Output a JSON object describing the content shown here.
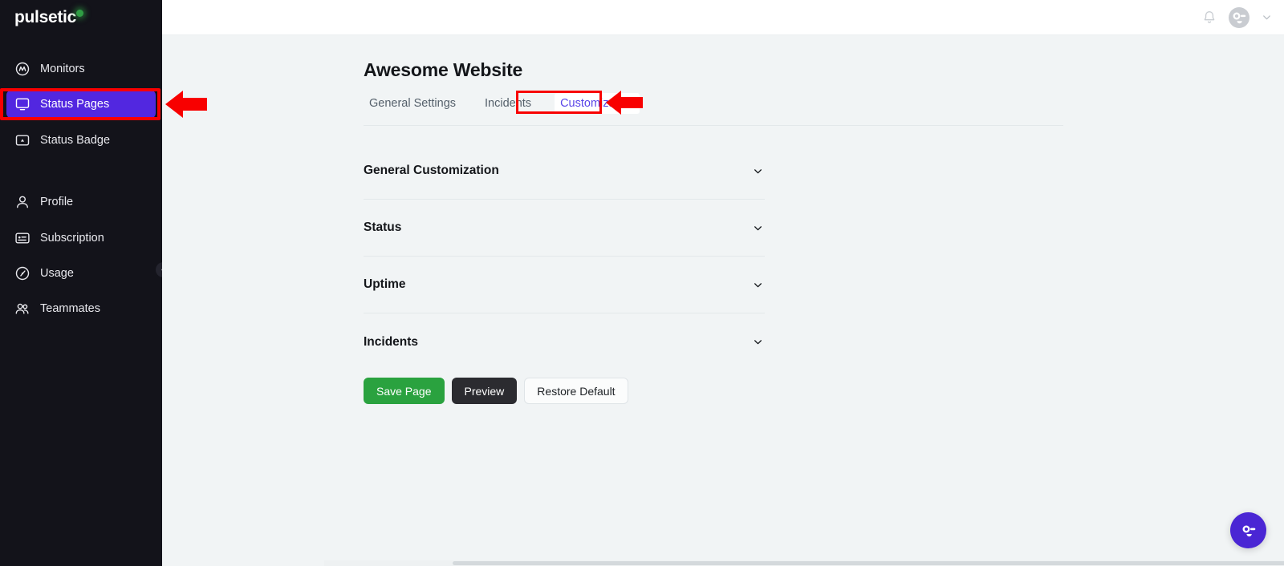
{
  "brand": {
    "name": "pulsetic",
    "dot_color": "#2f9e44",
    "accent": "#5227e0"
  },
  "sidebar": {
    "items": [
      {
        "label": "Monitors",
        "icon": "monitors-icon",
        "active": false
      },
      {
        "label": "Status Pages",
        "icon": "status-pages-icon",
        "active": true
      },
      {
        "label": "Status Badge",
        "icon": "status-badge-icon",
        "active": false
      },
      {
        "label": "Profile",
        "icon": "profile-icon",
        "active": false
      },
      {
        "label": "Subscription",
        "icon": "subscription-icon",
        "active": false
      },
      {
        "label": "Usage",
        "icon": "usage-icon",
        "active": false
      },
      {
        "label": "Teammates",
        "icon": "teammates-icon",
        "active": false
      }
    ],
    "collapse_icon": "chevron-left-icon"
  },
  "header": {
    "notifications_icon": "bell-icon",
    "avatar_icon": "avatar-face-icon",
    "account_caret_icon": "chevron-down-icon"
  },
  "main": {
    "title": "Awesome Website",
    "tabs": [
      {
        "label": "General Settings",
        "active": false
      },
      {
        "label": "Incidents",
        "active": false
      },
      {
        "label": "Customization",
        "active": true
      }
    ],
    "accordions": [
      {
        "label": "General Customization",
        "chevron": "chevron-down-icon",
        "expanded": false
      },
      {
        "label": "Status",
        "chevron": "chevron-down-icon",
        "expanded": false
      },
      {
        "label": "Uptime",
        "chevron": "chevron-down-icon",
        "expanded": false
      },
      {
        "label": "Incidents",
        "chevron": "chevron-down-icon",
        "expanded": false
      }
    ],
    "buttons": {
      "save": "Save Page",
      "preview": "Preview",
      "restore": "Restore Default"
    }
  },
  "chat_widget": {
    "icon": "chat-face-icon",
    "color": "#4a26d4"
  },
  "annotations": {
    "color": "#f80000",
    "highlights": [
      {
        "target": "sidebar-item-status-pages",
        "shape": "rectangle"
      },
      {
        "target": "tab-customization",
        "shape": "rectangle"
      }
    ],
    "arrows": [
      {
        "target": "sidebar-item-status-pages",
        "direction": "left"
      },
      {
        "target": "tab-customization",
        "direction": "left"
      }
    ]
  }
}
